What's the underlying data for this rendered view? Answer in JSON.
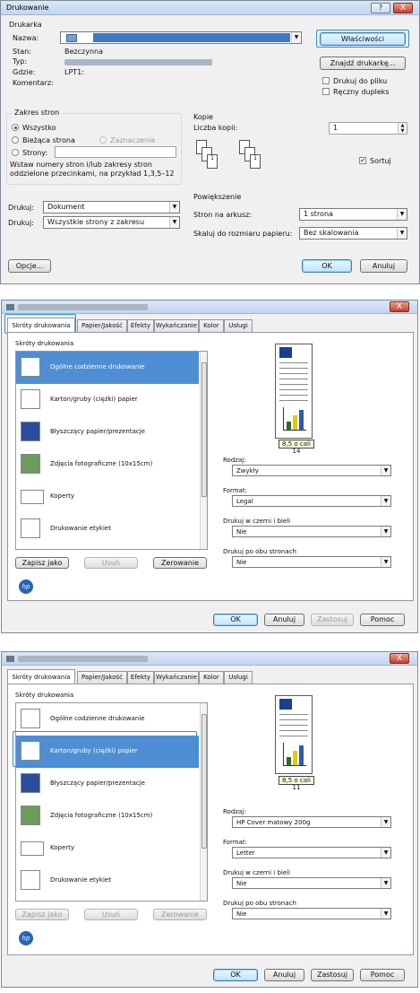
{
  "dlg1": {
    "title": "Drukowanie",
    "help_btn": "?",
    "close_btn": "X",
    "printer_group": "Drukarka",
    "name_label": "Nazwa:",
    "status_label": "Stan:",
    "status_value": "Bezczynna",
    "type_label": "Typ:",
    "where_label": "Gdzie:",
    "where_value": "LPT1:",
    "comment_label": "Komentarz:",
    "properties_btn": "Właściwości",
    "find_printer_btn": "Znajdź drukarkę...",
    "print_to_file": "Drukuj do pliku",
    "manual_duplex": "Ręczny dupleks",
    "range_group": "Zakres stron",
    "all_radio": "Wszystko",
    "current_page_radio": "Bieżąca strona",
    "selection_radio": "Zaznaczenie",
    "pages_radio": "Strony:",
    "range_hint_1": "Wstaw numery stron i/lub zakresy stron",
    "range_hint_2": "oddzielone przecinkami, na przykład 1,3,5–12",
    "copies_group": "Kopie",
    "copies_label": "Liczba kopii:",
    "copies_value": "1",
    "collate": "Sortuj",
    "print_what_label": "Drukuj:",
    "print_what_value": "Dokument",
    "print_label": "Drukuj:",
    "print_value": "Wszystkie strony z zakresu",
    "zoom_group": "Powiększenie",
    "pages_per_sheet_label": "Stron na arkusz:",
    "pages_per_sheet_value": "1 strona",
    "scale_label": "Skaluj do rozmiaru papieru:",
    "scale_value": "Bez skalowania",
    "options_btn": "Opcje...",
    "ok_btn": "OK",
    "cancel_btn": "Anuluj"
  },
  "dlg2": {
    "close_btn": "X",
    "tabs": [
      "Skróty drukowania",
      "Papier/Jakość",
      "Efekty",
      "Wykańczanie",
      "Kolor",
      "Usługi"
    ],
    "shortcuts_heading": "Skróty drukowania",
    "items": [
      "Ogólne codzienne drukowanie",
      "Karton/gruby (ciężki) papier",
      "Błyszczący papier/prezentacje",
      "Zdjęcia fotograficzne (10x15cm)",
      "Koperty",
      "Drukowanie etykiet"
    ],
    "save_as_btn": "Zapisz jako",
    "delete_btn": "Usuń",
    "reset_btn": "Zerowanie",
    "page_counter": "8,5 o cali 14",
    "type_label": "Rodzaj:",
    "type_value": "Zwykły",
    "format_label": "Format:",
    "format_value": "Legal",
    "bw_label": "Drukuj w czerni i bieli",
    "bw_value": "Nie",
    "duplex_label": "Drukuj po obu stronach",
    "duplex_value": "Nie",
    "hp_logo": "hp",
    "ok_btn": "OK",
    "cancel_btn": "Anuluj",
    "apply_btn": "Zastosuj",
    "help_btn": "Pomoc"
  },
  "dlg3": {
    "close_btn": "X",
    "tabs": [
      "Skróty drukowania",
      "Papier/Jakość",
      "Efekty",
      "Wykańczanie",
      "Kolor",
      "Usługi"
    ],
    "shortcuts_heading": "Skróty drukowania",
    "items": [
      "Ogólne codzienne drukowanie",
      "Karton/gruby (ciężki) papier",
      "Błyszczący papier/prezentacje",
      "Zdjęcia fotograficzne (10x15cm)",
      "Koperty",
      "Drukowanie etykiet"
    ],
    "save_as_btn": "Zapisz jako",
    "delete_btn": "Usuń",
    "reset_btn": "Zerowanie",
    "page_counter": "8,5 o cali 11",
    "type_label": "Rodzaj:",
    "type_value": "HP Cover matowy 200g",
    "format_label": "Format:",
    "format_value": "Letter",
    "bw_label": "Drukuj w czerni i bieli",
    "bw_value": "Nie",
    "duplex_label": "Drukuj po obu stronach",
    "duplex_value": "Nie",
    "hp_logo": "hp",
    "ok_btn": "OK",
    "cancel_btn": "Anuluj",
    "apply_btn": "Zastosuj",
    "help_btn": "Pomoc"
  },
  "colors": {
    "selection": "#4f8ed3",
    "highlight": "#2f8fd5",
    "hp_blue": "#2a64b0"
  }
}
